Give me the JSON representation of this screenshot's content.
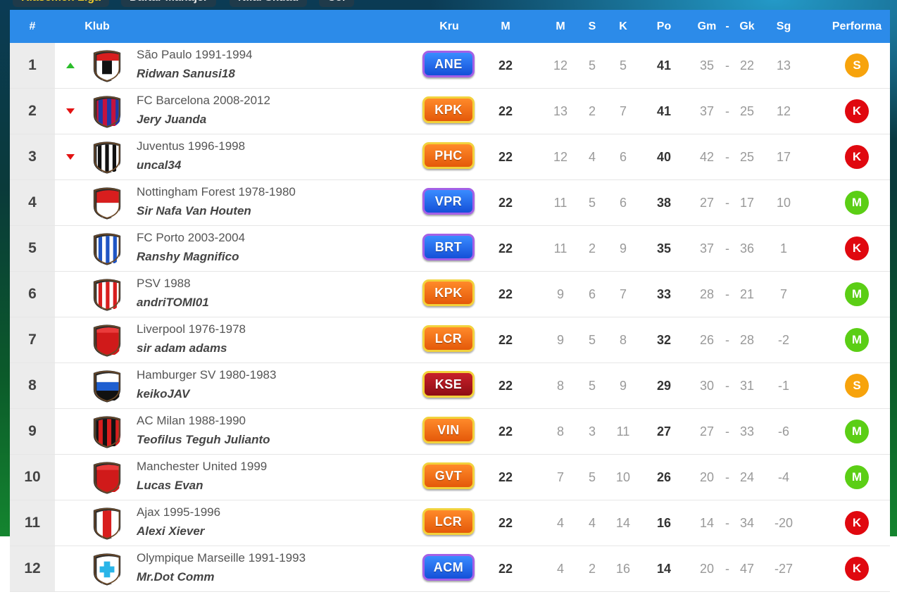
{
  "top_tabs": [
    "Klasemen Liga",
    "Daftar Manajer",
    "Nilai Skuad",
    "Cef"
  ],
  "colors": {
    "header_bg": "#2c8be9",
    "perf_S": "#f7a30c",
    "perf_K": "#e0080f",
    "perf_M": "#5bce15",
    "arrow_up": "#2bbd2b",
    "arrow_down": "#e31212"
  },
  "headers": {
    "rank": "#",
    "club": "Klub",
    "crew": "Kru",
    "played": "M",
    "won": "M",
    "drawn": "S",
    "lost": "K",
    "points": "Po",
    "gf": "Gm",
    "dash": "-",
    "ga": "Gk",
    "gd": "Sg",
    "form": "Performa"
  },
  "rows": [
    {
      "rank": "1",
      "trend": "up",
      "crest": "shield-tpl",
      "club": "São Paulo 1991-1994",
      "manager": "Ridwan Sanusi18",
      "crew": "ANE",
      "crew_color": "blue",
      "played": "22",
      "won": "12",
      "drawn": "5",
      "lost": "5",
      "points": "41",
      "gf": "35",
      "dash": "-",
      "ga": "22",
      "gd": "13",
      "form": "S"
    },
    {
      "rank": "2",
      "trend": "down",
      "crest": "shield-blaugrana",
      "club": "FC Barcelona 2008-2012",
      "manager": "Jery Juanda",
      "crew": "KPK",
      "crew_color": "orange",
      "played": "22",
      "won": "13",
      "drawn": "2",
      "lost": "7",
      "points": "41",
      "gf": "37",
      "dash": "-",
      "ga": "25",
      "gd": "12",
      "form": "K"
    },
    {
      "rank": "3",
      "trend": "down",
      "crest": "shield-black-white",
      "club": "Juventus 1996-1998",
      "manager": "uncal34",
      "crew": "PHC",
      "crew_color": "orange",
      "played": "22",
      "won": "12",
      "drawn": "4",
      "lost": "6",
      "points": "40",
      "gf": "42",
      "dash": "-",
      "ga": "25",
      "gd": "17",
      "form": "K"
    },
    {
      "rank": "4",
      "trend": "",
      "crest": "shield-red-white",
      "club": "Nottingham Forest 1978-1980",
      "manager": "Sir Nafa Van Houten",
      "crew": "VPR",
      "crew_color": "blue",
      "played": "22",
      "won": "11",
      "drawn": "5",
      "lost": "6",
      "points": "38",
      "gf": "27",
      "dash": "-",
      "ga": "17",
      "gd": "10",
      "form": "M"
    },
    {
      "rank": "5",
      "trend": "",
      "crest": "shield-blue-stripes",
      "club": "FC Porto 2003-2004",
      "manager": "Ranshy Magnifico",
      "crew": "BRT",
      "crew_color": "blue",
      "played": "22",
      "won": "11",
      "drawn": "2",
      "lost": "9",
      "points": "35",
      "gf": "37",
      "dash": "-",
      "ga": "36",
      "gd": "1",
      "form": "K"
    },
    {
      "rank": "6",
      "trend": "",
      "crest": "shield-red-stripes",
      "club": "PSV 1988",
      "manager": "andriTOMI01",
      "crew": "KPK",
      "crew_color": "orange",
      "played": "22",
      "won": "9",
      "drawn": "6",
      "lost": "7",
      "points": "33",
      "gf": "28",
      "dash": "-",
      "ga": "21",
      "gd": "7",
      "form": "M"
    },
    {
      "rank": "7",
      "trend": "",
      "crest": "shield-red",
      "club": "Liverpool 1976-1978",
      "manager": "sir adam adams",
      "crew": "LCR",
      "crew_color": "orange",
      "played": "22",
      "won": "9",
      "drawn": "5",
      "lost": "8",
      "points": "32",
      "gf": "26",
      "dash": "-",
      "ga": "28",
      "gd": "-2",
      "form": "M"
    },
    {
      "rank": "8",
      "trend": "",
      "crest": "shield-hsv",
      "club": "Hamburger SV 1980-1983",
      "manager": "keikoJAV",
      "crew": "KSE",
      "crew_color": "red",
      "played": "22",
      "won": "8",
      "drawn": "5",
      "lost": "9",
      "points": "29",
      "gf": "30",
      "dash": "-",
      "ga": "31",
      "gd": "-1",
      "form": "S"
    },
    {
      "rank": "9",
      "trend": "",
      "crest": "shield-red-black",
      "club": "AC Milan 1988-1990",
      "manager": "Teofilus Teguh Julianto",
      "crew": "VIN",
      "crew_color": "orange",
      "played": "22",
      "won": "8",
      "drawn": "3",
      "lost": "11",
      "points": "27",
      "gf": "27",
      "dash": "-",
      "ga": "33",
      "gd": "-6",
      "form": "M"
    },
    {
      "rank": "10",
      "trend": "",
      "crest": "shield-red",
      "club": "Manchester United 1999",
      "manager": "Lucas Evan",
      "crew": "GVT",
      "crew_color": "orange",
      "played": "22",
      "won": "7",
      "drawn": "5",
      "lost": "10",
      "points": "26",
      "gf": "20",
      "dash": "-",
      "ga": "24",
      "gd": "-4",
      "form": "M"
    },
    {
      "rank": "11",
      "trend": "",
      "crest": "shield-ajax",
      "club": "Ajax 1995-1996",
      "manager": "Alexi Xiever",
      "crew": "LCR",
      "crew_color": "orange",
      "played": "22",
      "won": "4",
      "drawn": "4",
      "lost": "14",
      "points": "16",
      "gf": "14",
      "dash": "-",
      "ga": "34",
      "gd": "-20",
      "form": "K"
    },
    {
      "rank": "12",
      "trend": "",
      "crest": "shield-cross",
      "club": "Olympique Marseille 1991-1993",
      "manager": "Mr.Dot Comm",
      "crew": "ACM",
      "crew_color": "blue",
      "played": "22",
      "won": "4",
      "drawn": "2",
      "lost": "16",
      "points": "14",
      "gf": "20",
      "dash": "-",
      "ga": "47",
      "gd": "-27",
      "form": "K"
    }
  ]
}
